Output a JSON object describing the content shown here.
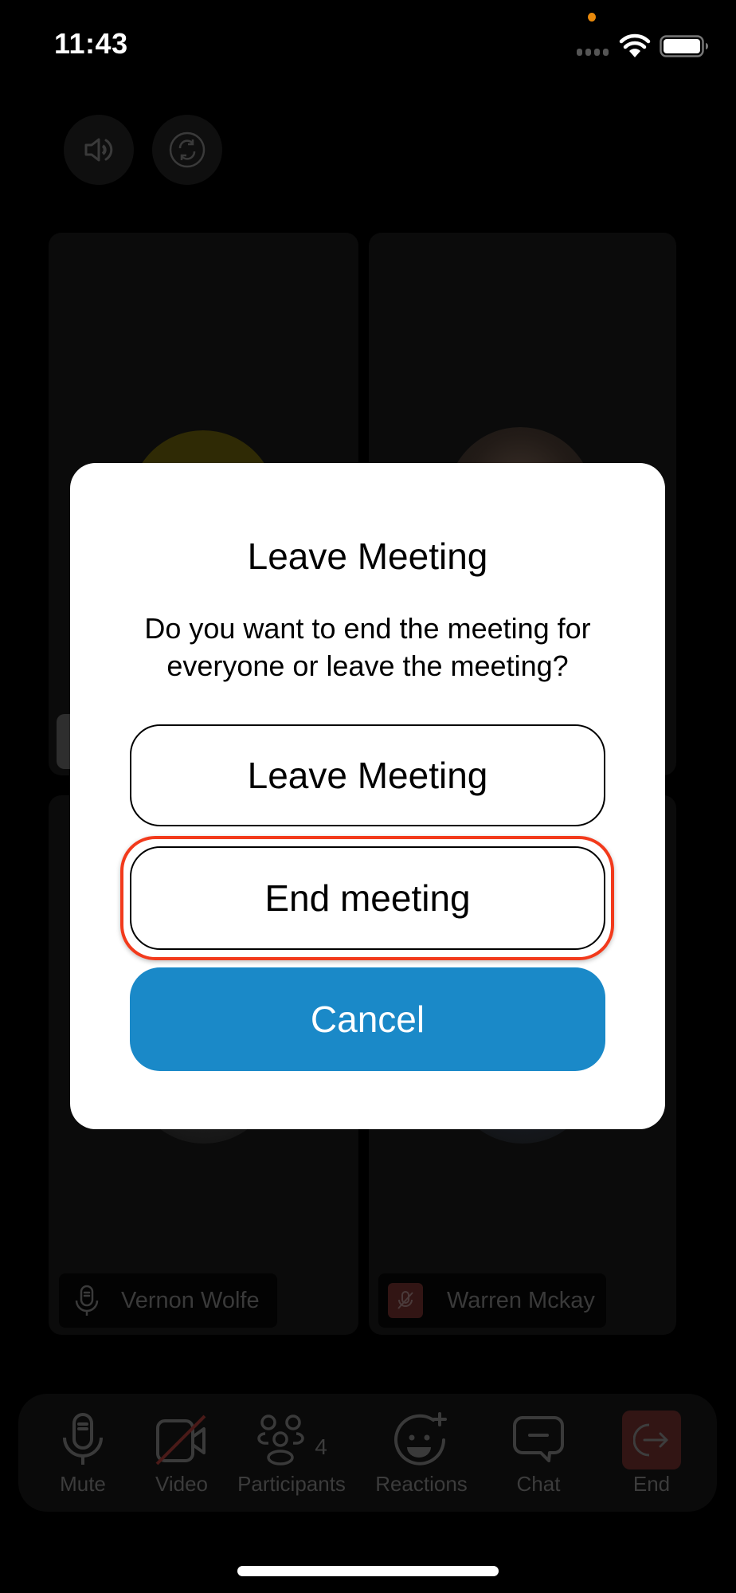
{
  "status_bar": {
    "time": "11:43",
    "icons": [
      "orange-recording-dot",
      "cellular-signal-icon",
      "wifi-icon",
      "battery-icon"
    ]
  },
  "top_controls": [
    {
      "name": "speaker-button",
      "icon": "speaker-icon"
    },
    {
      "name": "switch-camera-button",
      "icon": "camera-switch-icon"
    }
  ],
  "tiles": [
    {
      "name": "",
      "avatar": "yellow"
    },
    {
      "name": "",
      "avatar": "photo"
    },
    {
      "name": "Vernon Wolfe",
      "mic": "on"
    },
    {
      "name": "Warren Mckay",
      "mic": "muted"
    }
  ],
  "toolbar": {
    "items": [
      {
        "label": "Mute",
        "icon": "microphone-icon"
      },
      {
        "label": "Video",
        "icon": "video-off-icon"
      },
      {
        "label": "Participants",
        "icon": "participants-icon",
        "count": "4"
      },
      {
        "label": "Reactions",
        "icon": "reaction-emoji-icon"
      },
      {
        "label": "Chat",
        "icon": "chat-icon"
      },
      {
        "label": "End",
        "icon": "leave-icon"
      }
    ]
  },
  "dialog": {
    "title": "Leave Meeting",
    "message": "Do you want to end the meeting for everyone or leave the meeting?",
    "leave_label": "Leave Meeting",
    "end_label": "End meeting",
    "cancel_label": "Cancel"
  },
  "colors": {
    "cancel_blue": "#1A89C8",
    "highlight_red": "#F23A1C",
    "end_red": "#321514",
    "background": "#000000"
  }
}
